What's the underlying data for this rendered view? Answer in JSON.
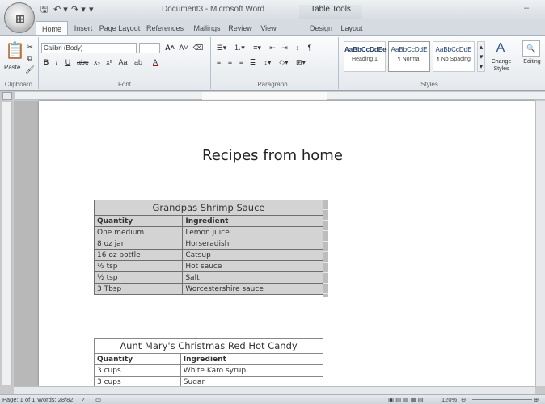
{
  "window": {
    "doc_title": "Document3 - Microsoft Word",
    "context_tab": "Table Tools",
    "quick_access": [
      "save-icon",
      "undo-icon",
      "redo-icon"
    ]
  },
  "tabs": [
    "Home",
    "Insert",
    "Page Layout",
    "References",
    "Mailings",
    "Review",
    "View",
    "Design",
    "Layout"
  ],
  "ribbon": {
    "clipboard": {
      "paste_label": "Paste",
      "group": "Clipboard"
    },
    "font": {
      "name": "Calibri (Body)",
      "size": "",
      "group": "Font"
    },
    "paragraph": {
      "group": "Paragraph"
    },
    "styles": {
      "group": "Styles",
      "items": [
        {
          "sample": "AaBbCcDdEe",
          "name": "Heading 1"
        },
        {
          "sample": "AaBbCcDdE",
          "name": "¶ Normal"
        },
        {
          "sample": "AaBbCcDdE",
          "name": "¶ No Spacing"
        }
      ],
      "change_styles": "Change Styles",
      "editing": "Editing"
    }
  },
  "document": {
    "heading": "Recipes from home",
    "table1": {
      "title": "Grandpas Shrimp Sauce",
      "headers": [
        "Quantity",
        "Ingredient"
      ],
      "rows": [
        [
          "One medium",
          "Lemon juice"
        ],
        [
          "8 oz jar",
          "Horseradish"
        ],
        [
          "16 oz bottle",
          "Catsup"
        ],
        [
          "½ tsp",
          "Hot sauce"
        ],
        [
          "½ tsp",
          "Salt"
        ],
        [
          "3 Tbsp",
          "Worcestershire sauce"
        ]
      ]
    },
    "table2": {
      "title": "Aunt Mary's Christmas Red Hot Candy",
      "headers": [
        "Quantity",
        "Ingredient"
      ],
      "rows": [
        [
          "3 cups",
          "White Karo syrup"
        ],
        [
          "3 cups",
          "Sugar"
        ]
      ]
    }
  },
  "status": {
    "page": "Page: 1 of 1",
    "words": "Words: 28/82",
    "zoom": "120%"
  }
}
